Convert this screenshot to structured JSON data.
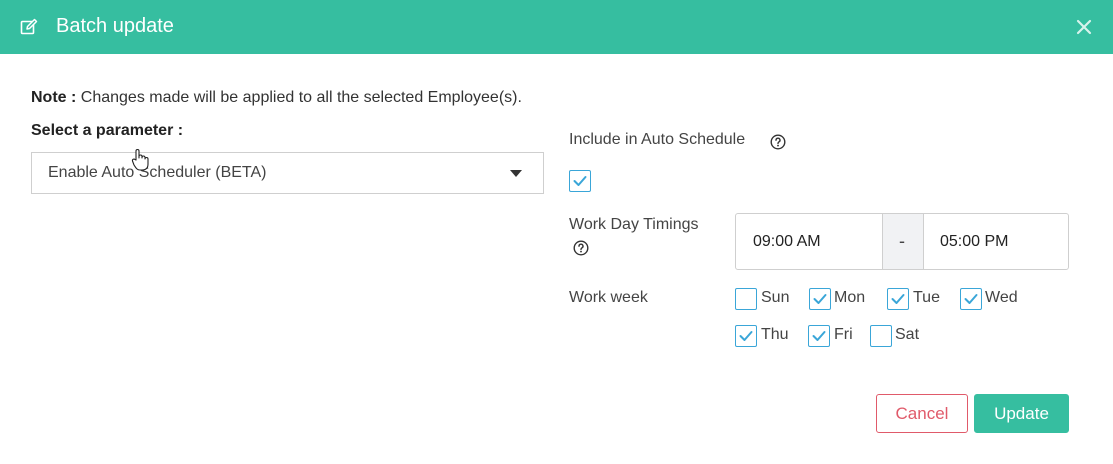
{
  "header": {
    "title": "Batch update",
    "icon": "edit-icon",
    "close_icon": "close-icon",
    "color": "#36bea0"
  },
  "note": {
    "label": "Note :",
    "text": "Changes made will be applied to all the selected Employee(s)."
  },
  "parameter": {
    "label": "Select a parameter :",
    "selected": "Enable Auto Scheduler (BETA)"
  },
  "auto_schedule": {
    "label": "Include in Auto Schedule",
    "checked": true
  },
  "work_day_timings": {
    "label": "Work Day Timings",
    "start": "09:00 AM",
    "separator": "-",
    "end": "05:00 PM"
  },
  "work_week": {
    "label": "Work week",
    "days": [
      {
        "name": "Sun",
        "checked": false
      },
      {
        "name": "Mon",
        "checked": true
      },
      {
        "name": "Tue",
        "checked": true
      },
      {
        "name": "Wed",
        "checked": true
      },
      {
        "name": "Thu",
        "checked": true
      },
      {
        "name": "Fri",
        "checked": true
      },
      {
        "name": "Sat",
        "checked": false
      }
    ]
  },
  "actions": {
    "cancel": "Cancel",
    "update": "Update"
  },
  "colors": {
    "accent": "#36bea0",
    "checkbox": "#3aa6d8",
    "danger": "#e05a6a"
  }
}
